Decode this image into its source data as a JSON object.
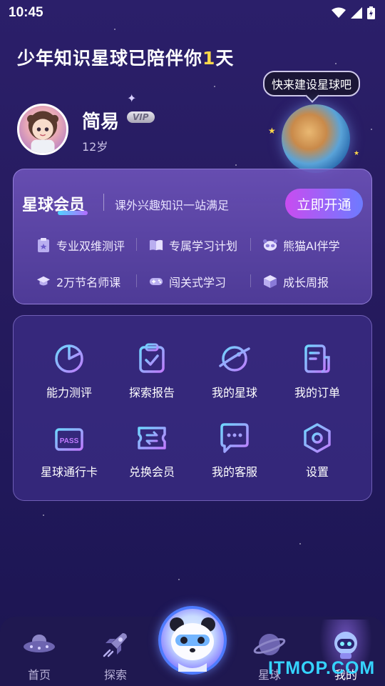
{
  "status_bar": {
    "time": "10:45"
  },
  "header": {
    "headline_prefix": "少年知识星球已陪伴你",
    "headline_days": "1",
    "headline_suffix": "天",
    "planet_bubble": "快来建设星球吧"
  },
  "profile": {
    "name": "简易",
    "vip_badge": "VIP",
    "age": "12岁"
  },
  "membership": {
    "title": "星球会员",
    "subtitle": "课外兴趣知识一站满足",
    "cta": "立即开通",
    "perks": [
      {
        "label": "专业双维测评",
        "icon": "clipboard-icon"
      },
      {
        "label": "专属学习计划",
        "icon": "open-book-icon"
      },
      {
        "label": "熊猫AI伴学",
        "icon": "panda-icon"
      },
      {
        "label": "2万节名师课",
        "icon": "graduation-cap-icon"
      },
      {
        "label": "闯关式学习",
        "icon": "gamepad-icon"
      },
      {
        "label": "成长周报",
        "icon": "cube-icon"
      }
    ]
  },
  "grid": {
    "items": [
      {
        "label": "能力测评",
        "icon": "pie-chart-icon"
      },
      {
        "label": "探索报告",
        "icon": "clipboard-check-icon"
      },
      {
        "label": "我的星球",
        "icon": "planet-icon"
      },
      {
        "label": "我的订单",
        "icon": "order-document-icon"
      },
      {
        "label": "星球通行卡",
        "icon": "pass-card-icon"
      },
      {
        "label": "兑换会员",
        "icon": "exchange-ticket-icon"
      },
      {
        "label": "我的客服",
        "icon": "chat-bubble-icon"
      },
      {
        "label": "设置",
        "icon": "settings-hexagon-icon"
      }
    ]
  },
  "bottom_nav": {
    "items": [
      {
        "label": "首页",
        "icon": "ufo-icon"
      },
      {
        "label": "探索",
        "icon": "rocket-icon"
      },
      {
        "label": "星球",
        "icon": "planet-nav-icon"
      },
      {
        "label": "我的",
        "icon": "robot-icon",
        "active": true
      }
    ]
  },
  "watermark": "ITMOP.COM",
  "colors": {
    "accent_yellow": "#ffd84a",
    "cta_start": "#c94cf0",
    "cta_end": "#6d7bff",
    "watermark": "#35d4ff"
  }
}
